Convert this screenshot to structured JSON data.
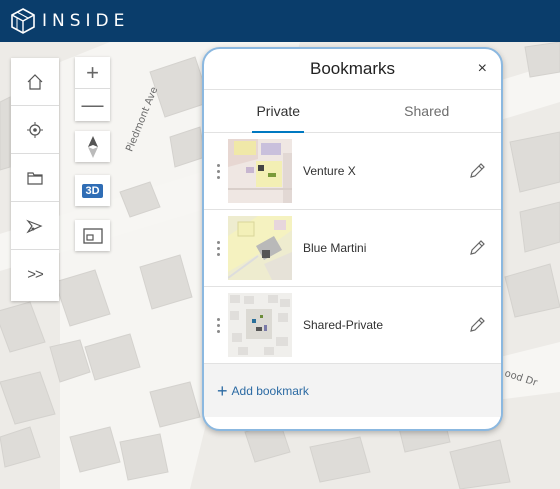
{
  "header": {
    "app_title": "INSIDE",
    "background": "#0a3d6b"
  },
  "map": {
    "street_labels": [
      "Piedmont Ave",
      "ood Dr"
    ]
  },
  "left_toolbar": {
    "items": [
      {
        "name": "home",
        "icon": "home-icon"
      },
      {
        "name": "locate",
        "icon": "locate-icon"
      },
      {
        "name": "layers",
        "icon": "folder-icon"
      },
      {
        "name": "directions",
        "icon": "directions-icon"
      },
      {
        "name": "more",
        "icon": "chevron-double-right-icon",
        "label": ">>"
      }
    ]
  },
  "map_controls": {
    "zoom_in": "+",
    "zoom_out": "—",
    "compass_icon": "compass-icon",
    "toggle_3d_label": "3D",
    "basemap_icon": "basemap-icon"
  },
  "bookmarks_panel": {
    "title": "Bookmarks",
    "close_label": "×",
    "tabs": [
      {
        "label": "Private",
        "active": true
      },
      {
        "label": "Shared",
        "active": false
      }
    ],
    "items": [
      {
        "label": "Venture X"
      },
      {
        "label": "Blue Martini"
      },
      {
        "label": "Shared-Private"
      }
    ],
    "add_label": "Add bookmark",
    "accent": "#0079c1"
  }
}
